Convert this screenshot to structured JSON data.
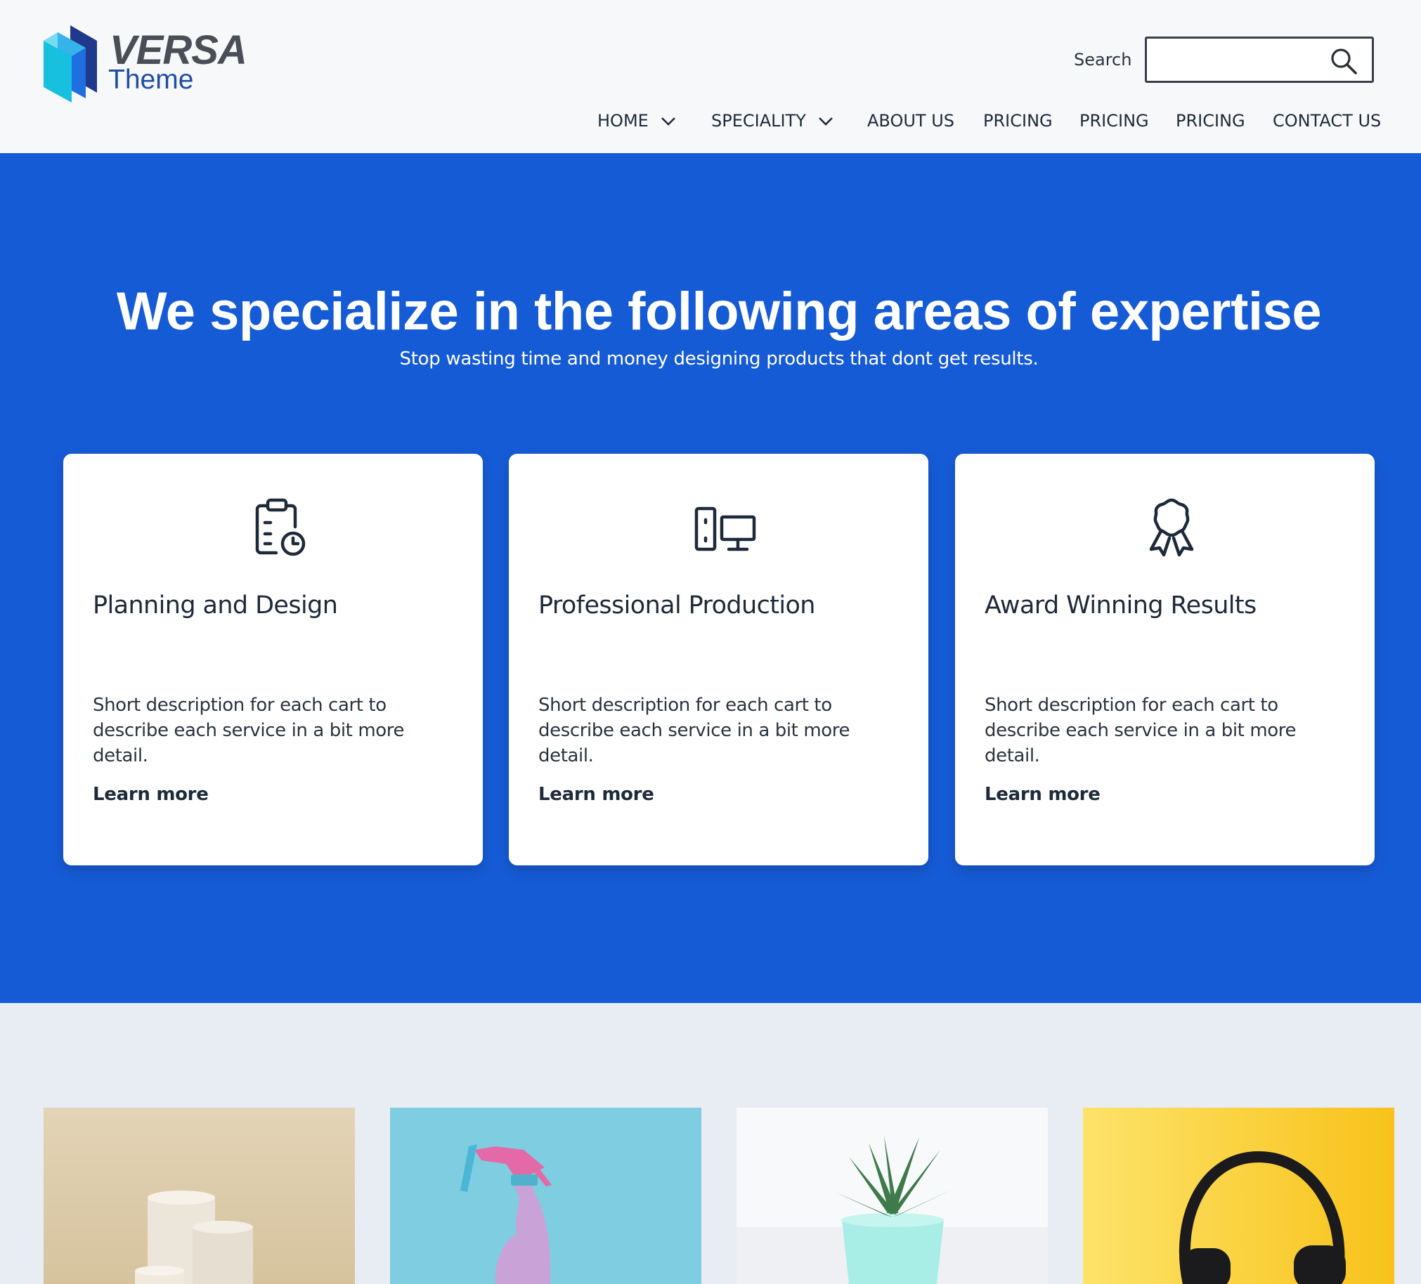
{
  "brand": {
    "name": "VERSA",
    "tagline": "Theme",
    "colors": {
      "blue_dark": "#1f3a8a",
      "blue": "#1f6fe0",
      "cyan": "#18c0e0"
    }
  },
  "search": {
    "label": "Search",
    "value": "",
    "placeholder": "",
    "icon": "search-icon"
  },
  "nav": {
    "items": [
      {
        "label": "HOME",
        "dropdown": true
      },
      {
        "label": "SPECIALITY",
        "dropdown": true
      },
      {
        "label": "ABOUT US",
        "dropdown": false
      },
      {
        "label": "PRICING",
        "dropdown": false
      },
      {
        "label": "PRICING",
        "dropdown": false
      },
      {
        "label": "PRICING",
        "dropdown": false
      },
      {
        "label": "CONTACT US",
        "dropdown": false
      }
    ]
  },
  "hero": {
    "title": "We specialize in the following areas of expertise",
    "subtitle": "Stop wasting time and money designing products that dont get results.",
    "background": "#165bd6"
  },
  "cards": [
    {
      "icon": "clipboard-clock-icon",
      "title": "Planning and Design",
      "description": "Short description for each cart to describe each service in a bit more detail.",
      "link": "Learn more"
    },
    {
      "icon": "devices-icon",
      "title": "Professional Production",
      "description": "Short description for each cart to describe each service in a bit more detail.",
      "link": "Learn more"
    },
    {
      "icon": "award-ribbon-icon",
      "title": "Award Winning Results",
      "description": "Short description for each cart to describe each service in a bit more detail.",
      "link": "Learn more"
    }
  ],
  "products": [
    {
      "image": "beige-podiums-image"
    },
    {
      "image": "spray-bottle-image"
    },
    {
      "image": "potted-succulent-image"
    },
    {
      "image": "headphones-image"
    }
  ]
}
